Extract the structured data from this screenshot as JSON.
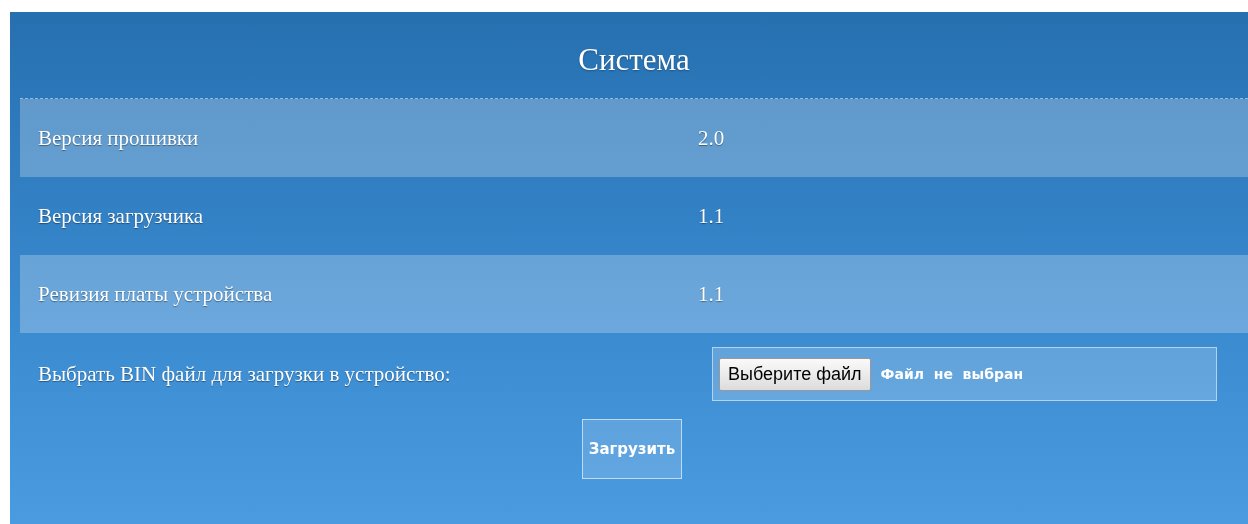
{
  "title": "Система",
  "rows": [
    {
      "label": "Версия прошивки",
      "value": "2.0"
    },
    {
      "label": "Версия загрузчика",
      "value": "1.1"
    },
    {
      "label": "Ревизия платы устройства",
      "value": "1.1"
    }
  ],
  "upload": {
    "label": "Выбрать BIN файл для загрузки в устройство:",
    "choose_button": "Выберите файл",
    "status": "Файл  не  выбран",
    "submit_button": "Загрузить"
  }
}
